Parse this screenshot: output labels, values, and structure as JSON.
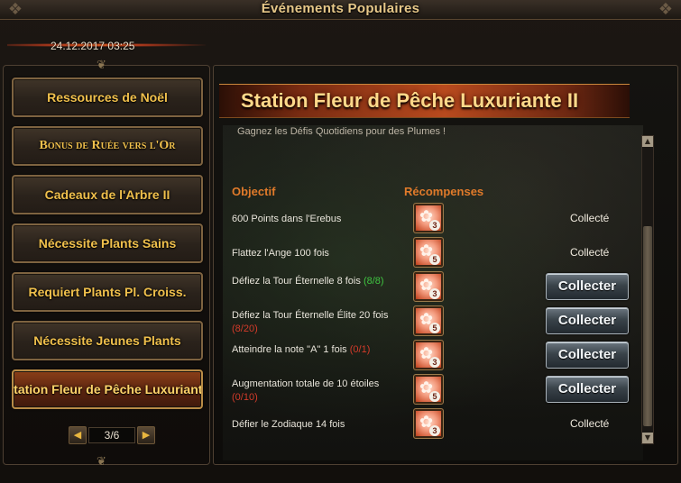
{
  "window": {
    "title": "Événements Populaires"
  },
  "date": "24.12.2017 03:25",
  "sidebar": {
    "items": [
      {
        "label": "Ressources de Noël",
        "style": "sans",
        "active": false
      },
      {
        "label": "Bonus de Ruée vers l'Or",
        "style": "serif",
        "active": false
      },
      {
        "label": "Cadeaux de l'Arbre II",
        "style": "sans",
        "active": false
      },
      {
        "label": "Nécessite Plants Sains",
        "style": "sans",
        "active": false
      },
      {
        "label": "Requiert Plants Pl. Croiss.",
        "style": "sans",
        "active": false
      },
      {
        "label": "Nécessite Jeunes Plants",
        "style": "sans",
        "active": false
      },
      {
        "label": "Station Fleur de Pêche Luxuriante",
        "style": "sans",
        "active": true
      }
    ],
    "pager": {
      "label": "3/6"
    }
  },
  "event": {
    "title": "Station Fleur de Pêche Luxuriante II",
    "subtitle": "Gagnez les Défis Quotidiens pour des Plumes !",
    "headers": {
      "objective": "Objectif",
      "rewards": "Récompenses"
    },
    "rows": [
      {
        "objective": "600 Points dans l'Erebus",
        "progress": "",
        "progress_ok": true,
        "reward_count": "3",
        "state": "collected",
        "status": "Collecté"
      },
      {
        "objective": "Flattez l'Ange 100 fois",
        "progress": "",
        "progress_ok": true,
        "reward_count": "5",
        "state": "collected",
        "status": "Collecté"
      },
      {
        "objective": "Défiez la Tour Éternelle 8 fois",
        "progress": "(8/8)",
        "progress_ok": true,
        "reward_count": "3",
        "state": "button",
        "status": "Collecter"
      },
      {
        "objective": "Défiez la Tour Éternelle Élite 20 fois",
        "progress": "(8/20)",
        "progress_ok": false,
        "reward_count": "5",
        "state": "button",
        "status": "Collecter"
      },
      {
        "objective": "Atteindre la note \"A\" 1 fois",
        "progress": "(0/1)",
        "progress_ok": false,
        "reward_count": "3",
        "state": "button",
        "status": "Collecter"
      },
      {
        "objective": "Augmentation totale de 10 étoiles",
        "progress": "(0/10)",
        "progress_ok": false,
        "reward_count": "5",
        "state": "button",
        "status": "Collecter"
      },
      {
        "objective": "Défier le Zodiaque 14 fois",
        "progress": "",
        "progress_ok": true,
        "reward_count": "3",
        "state": "collected",
        "status": "Collecté"
      }
    ]
  },
  "colors": {
    "gold": "#f0c04c",
    "header_orange": "#e07a2a",
    "progress_ok": "#3fc441",
    "progress_bad": "#d23b2a"
  },
  "icons": {
    "reward": "peach-blossom-icon",
    "prev": "triangle-left-icon",
    "next": "triangle-right-icon"
  }
}
